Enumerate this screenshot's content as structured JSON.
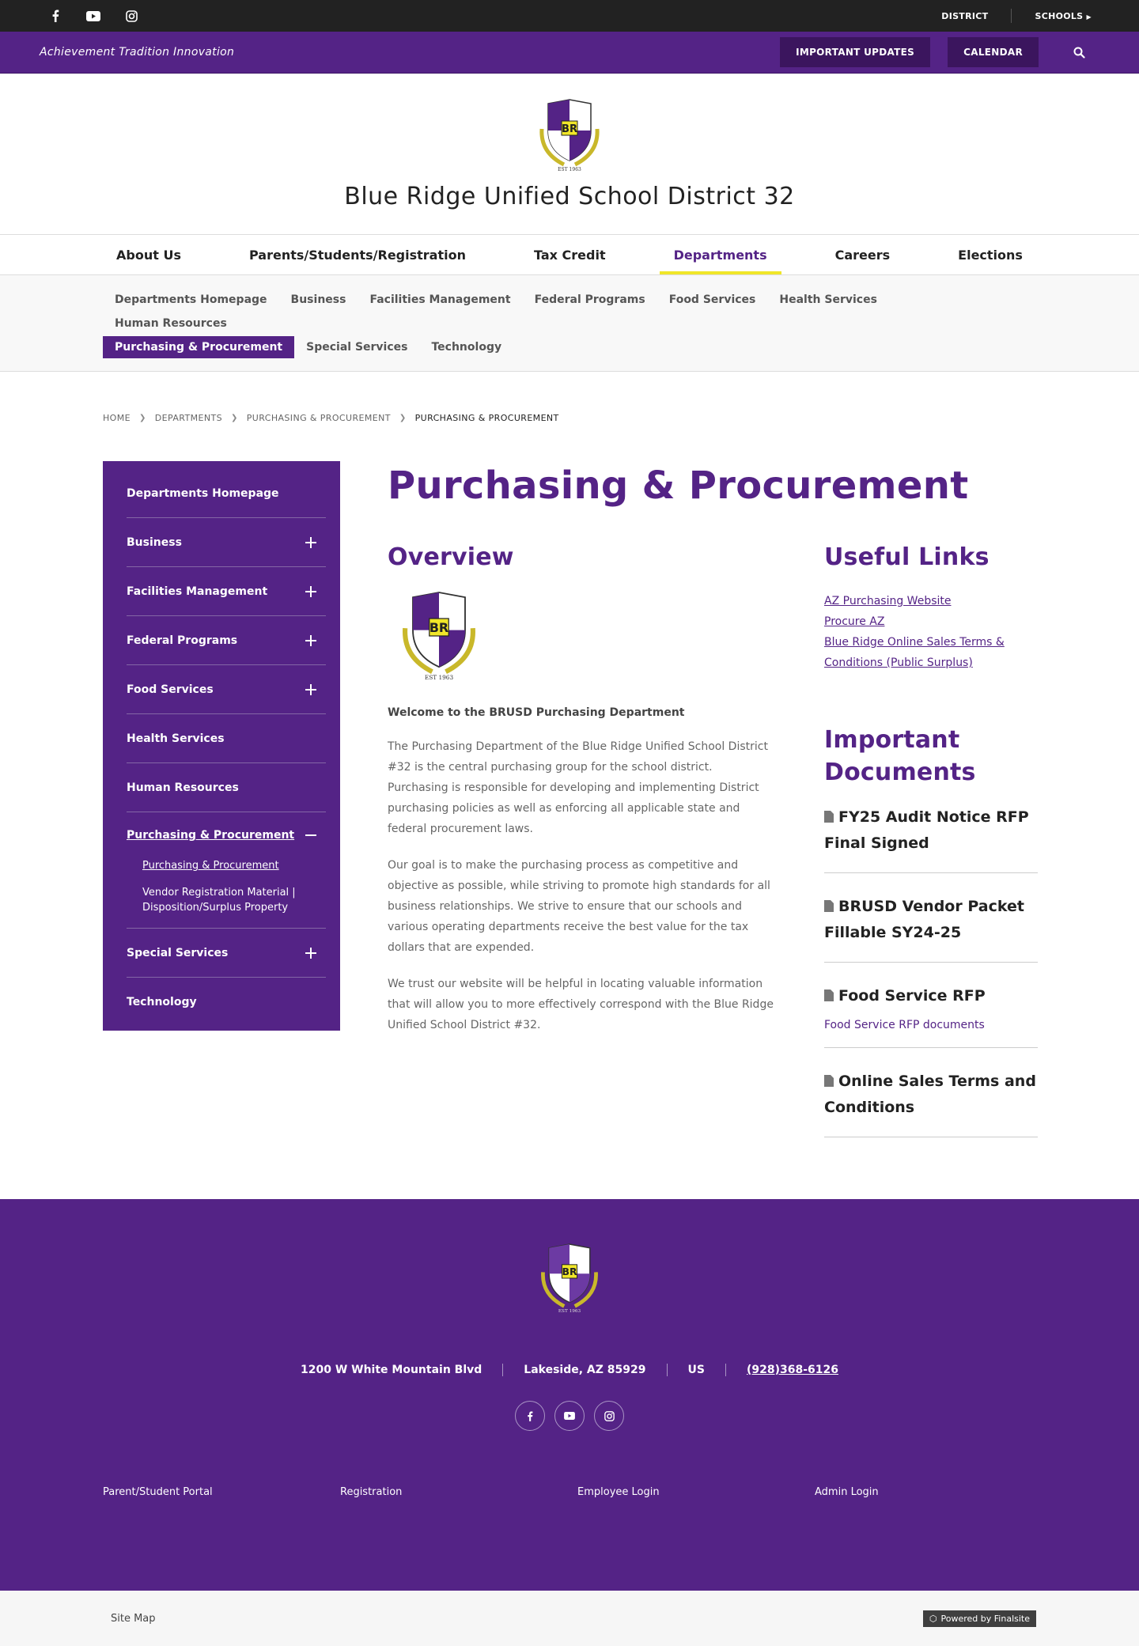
{
  "topbar": {
    "social_icons": [
      "facebook-icon",
      "youtube-icon",
      "instagram-icon"
    ],
    "district": "DISTRICT",
    "schools": "SCHOOLS"
  },
  "purplebar": {
    "tagline": "Achievement Tradition Innovation",
    "important_updates": "IMPORTANT UPDATES",
    "calendar": "CALENDAR"
  },
  "header": {
    "title": "Blue Ridge Unified School District 32"
  },
  "crest": {
    "letters": "BR",
    "est": "EST 1963"
  },
  "mainnav": [
    {
      "label": "About Us"
    },
    {
      "label": "Parents/Students/Registration"
    },
    {
      "label": "Tax Credit"
    },
    {
      "label": "Departments",
      "active": true
    },
    {
      "label": "Careers"
    },
    {
      "label": "Elections"
    }
  ],
  "subnav": [
    {
      "label": "Departments Homepage"
    },
    {
      "label": "Business"
    },
    {
      "label": "Facilities Management"
    },
    {
      "label": "Federal Programs"
    },
    {
      "label": "Food Services"
    },
    {
      "label": "Health Services"
    },
    {
      "label": "Human Resources"
    },
    {
      "label": "Purchasing & Procurement",
      "active": true
    },
    {
      "label": "Special Services"
    },
    {
      "label": "Technology"
    }
  ],
  "breadcrumb": [
    "HOME",
    "DEPARTMENTS",
    "PURCHASING & PROCUREMENT",
    "PURCHASING & PROCUREMENT"
  ],
  "sidebar": {
    "items": [
      {
        "label": "Departments Homepage"
      },
      {
        "label": "Business"
      },
      {
        "label": "Facilities Management"
      },
      {
        "label": "Federal Programs"
      },
      {
        "label": "Food Services"
      },
      {
        "label": "Health Services"
      },
      {
        "label": "Human Resources"
      },
      {
        "label": "Purchasing & Procurement"
      },
      {
        "label": "Special Services"
      },
      {
        "label": "Technology"
      }
    ],
    "sub_items": [
      {
        "label": "Purchasing & Procurement"
      },
      {
        "label": "Vendor Registration Material | Disposition/Surplus Property"
      }
    ]
  },
  "main": {
    "title": "Purchasing & Procurement",
    "overview_heading": "Overview",
    "welcome": "Welcome to the BRUSD Purchasing Department",
    "paragraphs": [
      "The Purchasing Department of the Blue Ridge Unified School District #32 is the central purchasing group for the school district. Purchasing is responsible for developing and implementing District purchasing policies as well as enforcing all applicable state and federal procurement laws.",
      "Our goal is to make the purchasing process as competitive and objective as possible, while striving to promote high standards for all business relationships.  We strive to ensure that our schools and various operating departments receive the best value for the tax dollars that are expended.",
      "We trust our website will be helpful in locating valuable information that will allow you to more effectively correspond with the Blue Ridge Unified School District #32."
    ],
    "useful_links_heading": "Useful Links",
    "useful_links": [
      "AZ Purchasing Website",
      "Procure AZ",
      "Blue Ridge Online Sales Terms & Conditions (Public Surplus)"
    ],
    "documents_heading": "Important Documents",
    "documents": [
      {
        "title": "FY25 Audit Notice RFP Final Signed"
      },
      {
        "title": "BRUSD Vendor Packet Fillable SY24-25"
      },
      {
        "title": "Food Service RFP",
        "sub": "Food Service RFP documents"
      },
      {
        "title": "Online Sales Terms and Conditions"
      }
    ]
  },
  "footer": {
    "address": "1200 W White Mountain Blvd",
    "city": "Lakeside, AZ  85929",
    "country": "US",
    "phone": "(928)368-6126",
    "social_icons": [
      "facebook-icon",
      "youtube-icon",
      "instagram-icon"
    ],
    "links": [
      "Parent/Student Portal",
      "Registration",
      "Employee Login",
      "Admin Login"
    ],
    "sitemap": "Site Map",
    "powered": "Powered by Finalsite"
  },
  "colors": {
    "brand_purple": "#542386",
    "dark_purple": "#3b155e",
    "accent_yellow": "#f0e629",
    "topbar": "#222222"
  }
}
